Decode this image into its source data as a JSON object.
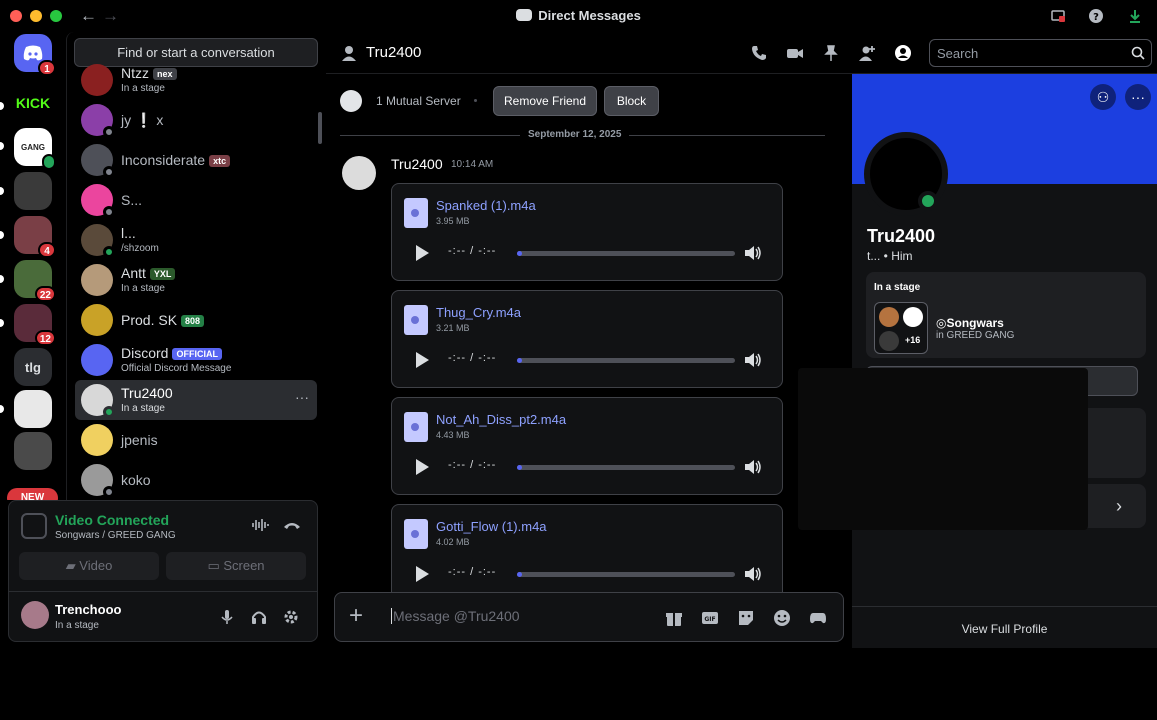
{
  "window": {
    "title": "Direct Messages"
  },
  "rail": {
    "servers": [
      {
        "id": "home",
        "badge": "1"
      },
      {
        "id": "kick",
        "label": "KICK"
      },
      {
        "id": "greed-gang"
      },
      {
        "id": "srv4"
      },
      {
        "id": "srv5",
        "badge": "4"
      },
      {
        "id": "srv6",
        "badge": "22"
      },
      {
        "id": "srv7",
        "badge": "12"
      },
      {
        "id": "tlg",
        "label": "tlg"
      },
      {
        "id": "srv9"
      },
      {
        "id": "srv10"
      }
    ],
    "new_label": "NEW"
  },
  "sidebar": {
    "search_label": "Find or start a conversation",
    "dms": [
      {
        "name": "Ntzz",
        "tag": "nex",
        "sub": "In a stage"
      },
      {
        "name": "jy ❕ x",
        "sub": ""
      },
      {
        "name": "Inconsiderate",
        "tag": "xtc",
        "sub": ""
      },
      {
        "name": "S...",
        "sub": ""
      },
      {
        "name": "l...",
        "sub": "/shzoom"
      },
      {
        "name": "Antt",
        "tag": "YXL",
        "sub": "In a stage"
      },
      {
        "name": "Prod. SK",
        "tag": "808",
        "sub": ""
      },
      {
        "name": "Discord",
        "tag": "OFFICIAL",
        "sub": "Official Discord Message"
      },
      {
        "name": "Tru2400",
        "sub": "In a stage"
      },
      {
        "name": "jpenis",
        "sub": ""
      },
      {
        "name": "koko",
        "sub": ""
      }
    ]
  },
  "voice": {
    "title": "Video Connected",
    "sub": "Songwars / GREED GANG",
    "video_label": "Video",
    "screen_label": "Screen"
  },
  "user": {
    "name": "Trenchooo",
    "status": "In a stage"
  },
  "chat": {
    "recipient": "Tru2400",
    "search_placeholder": "Search",
    "mutual": "1 Mutual Server",
    "remove_friend": "Remove Friend",
    "block": "Block",
    "date": "September 12, 2025",
    "message": {
      "author": "Tru2400",
      "time": "10:14 AM"
    },
    "attachments": [
      {
        "name": "Spanked (1).m4a",
        "size": "3.95 MB",
        "time": "-:--  /  -:--"
      },
      {
        "name": "Thug_Cry.m4a",
        "size": "3.21 MB",
        "time": "-:--  /  -:--"
      },
      {
        "name": "Not_Ah_Diss_pt2.m4a",
        "size": "4.43 MB",
        "time": "-:--  /  -:--"
      },
      {
        "name": "Gotti_Flow (1).m4a",
        "size": "4.02 MB",
        "time": "-:--  /  -:--"
      }
    ],
    "composer_placeholder": "Message @Tru2400"
  },
  "profile": {
    "name": "Tru2400",
    "sub": "t...  •  Him",
    "stage_heading": "In a stage",
    "stage_name": "Songwars",
    "stage_server": "in GREED GANG",
    "stage_count": "+16",
    "view_full": "View Full Profile"
  },
  "colors": {
    "accent": "#5865f2",
    "online": "#23a55a",
    "danger": "#da373c",
    "banner": "#1c3fe0"
  }
}
